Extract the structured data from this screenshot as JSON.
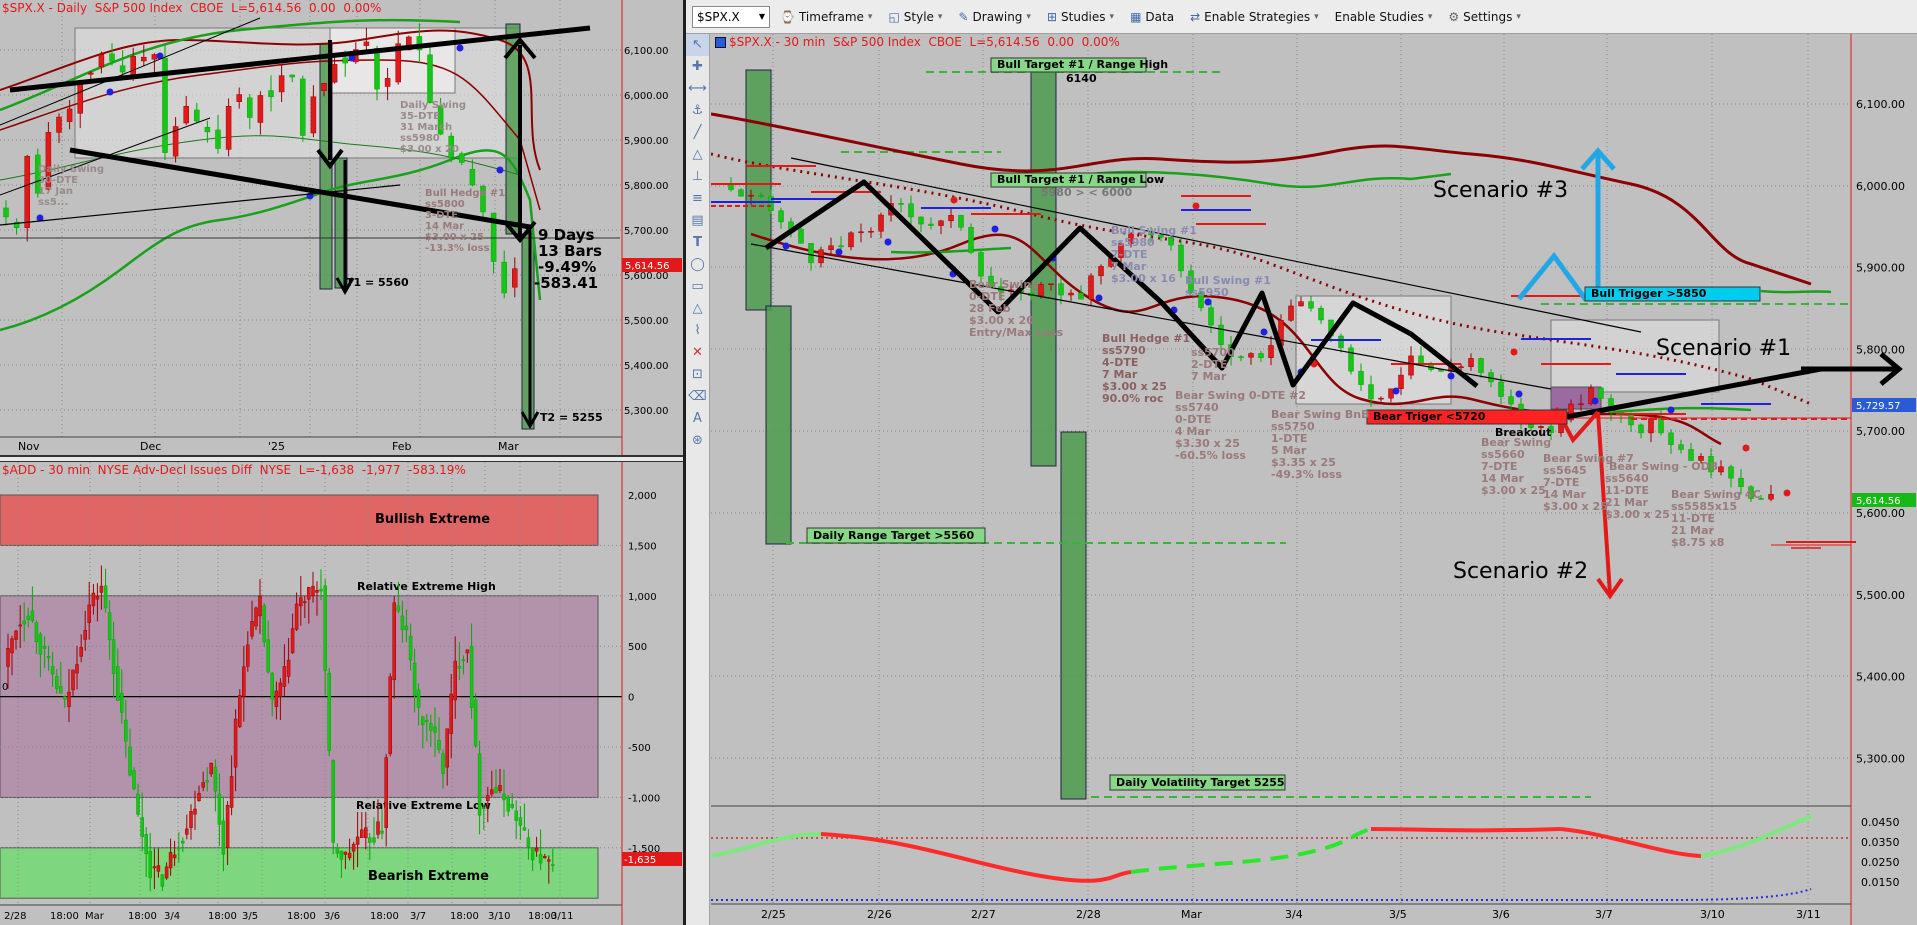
{
  "toolbar": {
    "symbol": "$SPX.X",
    "items": [
      "Timeframe",
      "Style",
      "Drawing",
      "Studies",
      "Data",
      "Enable Strategies",
      "Enable Studies",
      "Settings"
    ]
  },
  "panel1": {
    "title": "$SPX.X - Daily  S&P 500 Index  CBOE  L=5,614.56  0.00  0.00%",
    "price_tag": "5,614.56",
    "y_ticks": [
      "6,100.00",
      "6,000.00",
      "5,900.00",
      "5,800.00",
      "5,700.00",
      "5,600.00",
      "5,500.00",
      "5,400.00",
      "5,300.00"
    ],
    "x_ticks": [
      "Nov",
      "Dec",
      "'25",
      "Feb",
      "Mar"
    ],
    "notes": {
      "days": "9 Days",
      "bars": "13 Bars",
      "pct": "-9.49%",
      "pts": "-583.41",
      "t1": "T1 = 5560",
      "t2": "T2 = 5255",
      "swing1": "Daily Swing\n35-DTE\n31 March\nss5980\n$3.00 x 20",
      "swing2": "Daily Swing\n30-DTE\n17 Jan\nss5...",
      "hedge": "Bull Hedge #1\nss5800\n3-DTE\n14 Mar\n$3.00 x 25\n-13.3% loss"
    }
  },
  "panel2": {
    "title": "$ADD - 30 min  NYSE Adv-Decl Issues Diff  NYSE  L=-1,638  -1,977  -583.19%",
    "price_tag": "-1,635",
    "y_ticks": [
      "2,000",
      "1,500",
      "1,000",
      "500",
      "0",
      "-500",
      "-1,000",
      "-1,500"
    ],
    "x_ticks": [
      "2/28",
      "18:00",
      "Mar",
      "18:00",
      "3/4",
      "18:00",
      "3/5",
      "18:00",
      "3/6",
      "18:00",
      "3/7",
      "18:00",
      "3/10",
      "18:00",
      "3/11"
    ],
    "zones": {
      "bull_extreme": "Bullish Extreme",
      "rel_high": "Relative Extreme High",
      "rel_low": "Relative Extreme Low",
      "bear_extreme": "Bearish Extreme"
    },
    "zero_label": "0"
  },
  "panel3": {
    "title": "$SPX.X - 30 min  S&P 500 Index  CBOE  L=5,614.56  0.00  0.00%",
    "price_tags": [
      "5,729.57",
      "5,614.56"
    ],
    "y_ticks": [
      "6,100.00",
      "6,000.00",
      "5,900.00",
      "5,800.00",
      "5,700.00",
      "5,600.00",
      "5,500.00",
      "5,400.00",
      "5,300.00"
    ],
    "x_ticks": [
      "2/25",
      "2/26",
      "2/27",
      "2/28",
      "Mar",
      "3/4",
      "3/5",
      "3/6",
      "3/7",
      "3/10",
      "3/11"
    ],
    "osc_ticks": [
      "0.0450",
      "0.0350",
      "0.0250",
      "0.0150"
    ],
    "labels": {
      "bull_target_high": "Bull Target #1 / Range High",
      "bull_target_high_val": "6140",
      "bull_target_low": "Bull Target #1 / Range Low",
      "bull_target_low_val": "5980 > < 6000",
      "daily_range_target": "Daily Range Target >5560",
      "daily_vol_target": "Daily Volatility Target 5255",
      "bull_trigger": "Bull Trigger >5850",
      "bear_trigger": "Bear Triger <5720",
      "breakout": "Breakout",
      "scenario1": "Scenario #1",
      "scenario2": "Scenario #2",
      "scenario3": "Scenario #3",
      "bear_swing_a": "Bear Swing\n0-DTE\n28 Feb\n$3.00 x 20\nEntry/Max Loss",
      "bull_hedge": "Bull Hedge #1\nss5790\n4-DTE\n7 Mar\n$3.00 x 25\n90.0% roc",
      "bull_swing": "Bull Swing #1\nss5980\n7-DTE\n7 Mar\n$3.00 x 16",
      "bull_swing_b": "Bull Swing #1\nss5950",
      "bear_swing_c": "Bear Swing 0-DTE #2\nss5740\n0-DTE\n4 Mar\n$3.30 x 25\n-60.5% loss",
      "bear_swing_d": "Bear Swing BnB\nss5750\n1-DTE\n5 Mar\n$3.35 x 25\n-49.3% loss",
      "bear_swing_e": "ss5700\n2-DTE\n7 Mar",
      "bear_swing_f": "Bear Swing\nss5660\n7-DTE\n14 Mar\n$3.00 x 25",
      "bear_swing_g": "Bear Swing #7\nss5645\n7-DTE\n14 Mar\n$3.00 x 25",
      "bear_swing_h": "ss5640\n11-DTE\n21 Mar\n$3.00 x 25",
      "bear_swing_odb": "Bear Swing - ODB",
      "bear_swing_i": "Bear Swing 4C\nss5585x15\n11-DTE\n21 Mar\n$8.75 x8"
    }
  },
  "colors": {
    "background": "#c0c0c0",
    "up": "#19c419",
    "down": "#e31919",
    "band_red": "#8b0000",
    "band_green": "#1aa01a",
    "cyan": "#00ccee",
    "blue_arrow": "#22a7e6"
  },
  "chart_data": [
    {
      "type": "candlestick",
      "title": "$SPX.X - Daily  S&P 500 Index  CBOE",
      "ylim": [
        5220,
        6200
      ],
      "xlabel": "",
      "ylabel": "",
      "x": [
        "Nov",
        "Dec",
        "'25",
        "Feb",
        "Mar"
      ],
      "series": [
        {
          "values": [
            5729,
            5705,
            5864,
            5782,
            5917,
            5951,
            5969,
            6032,
            6049,
            6090,
            6075,
            6051,
            6086,
            6084,
            6090,
            5872,
            5930,
            5975,
            5942,
            5918,
            5881,
            5975,
            6001,
            5950,
            5999,
            5996,
            6043,
            6040,
            5910,
            5996,
            6026,
            6068,
            6071,
            6101,
            6118,
            6013,
            6037,
            6114,
            6129,
            6100,
            5983,
            5913,
            5861,
            5850,
            5800,
            5740,
            5630,
            5560,
            5614
          ]
        }
      ]
    },
    {
      "type": "candlestick",
      "title": "$ADD - 30 min  NYSE Adv-Decl Issues Diff  NYSE",
      "ylim": [
        -2100,
        2100
      ],
      "x": [
        "2/28",
        "Mar",
        "3/4",
        "3/5",
        "3/6",
        "3/7",
        "3/10",
        "3/11"
      ]
    },
    {
      "type": "candlestick",
      "title": "$SPX.X - 30 min  S&P 500 Index  CBOE",
      "ylim": [
        5200,
        6200
      ],
      "x": [
        "2/25",
        "2/26",
        "2/27",
        "2/28",
        "Mar",
        "3/4",
        "3/5",
        "3/6",
        "3/7",
        "3/10",
        "3/11"
      ],
      "series": [
        {
          "values": [
            5983,
            5955,
            5915,
            5925,
            5950,
            5980,
            5955,
            5955,
            5880,
            5860,
            5885,
            5860,
            5920,
            5950,
            5920,
            5849,
            5790,
            5780,
            5860,
            5840,
            5770,
            5740,
            5800,
            5770,
            5790,
            5738,
            5700,
            5710,
            5745,
            5720,
            5705,
            5680,
            5660,
            5640,
            5614
          ]
        }
      ]
    }
  ]
}
